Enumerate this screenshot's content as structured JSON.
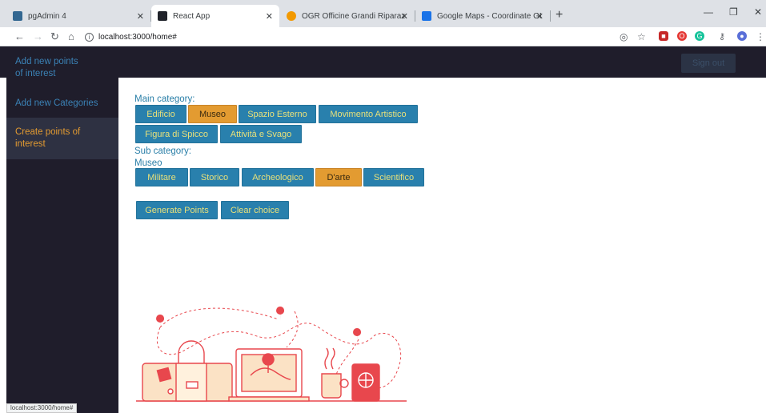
{
  "browser": {
    "tabs": [
      {
        "title": "pgAdmin 4",
        "favicon_color": "#336791",
        "active": false
      },
      {
        "title": "React App",
        "favicon_color": "#20232a",
        "active": true
      },
      {
        "title": "OGR Officine Grandi Riparazioni",
        "favicon_color": "#f29900",
        "active": false
      },
      {
        "title": "Google Maps - Coordinate GPS -",
        "favicon_color": "#1a73e8",
        "active": false
      }
    ],
    "url": "localhost:3000/home#",
    "status_url": "localhost:3000/home#"
  },
  "header": {
    "signout_label": "Sign out"
  },
  "sidebar": {
    "items": [
      {
        "label": "Add new points of interest"
      },
      {
        "label": "Add new Categories"
      },
      {
        "label": "Create points of interest"
      }
    ]
  },
  "main": {
    "main_category_label": "Main category:",
    "main_categories": [
      {
        "label": "Edificio"
      },
      {
        "label": "Museo",
        "selected": true
      },
      {
        "label": "Spazio Esterno"
      },
      {
        "label": "Movimento Artistico"
      },
      {
        "label": "Figura di Spicco"
      },
      {
        "label": "Attività e Svago"
      }
    ],
    "sub_category_label": "Sub category:",
    "selected_main": "Museo",
    "sub_categories": [
      {
        "label": "Militare"
      },
      {
        "label": "Storico"
      },
      {
        "label": "Archeologico"
      },
      {
        "label": "D'arte",
        "selected": true
      },
      {
        "label": "Scientifico"
      }
    ],
    "generate_label": "Generate Points",
    "clear_label": "Clear choice"
  },
  "colors": {
    "accent_orange": "#e39b31",
    "button_blue": "#2980ad",
    "sidebar_bg": "#1f1d2b",
    "illustration_red": "#e8474d"
  }
}
